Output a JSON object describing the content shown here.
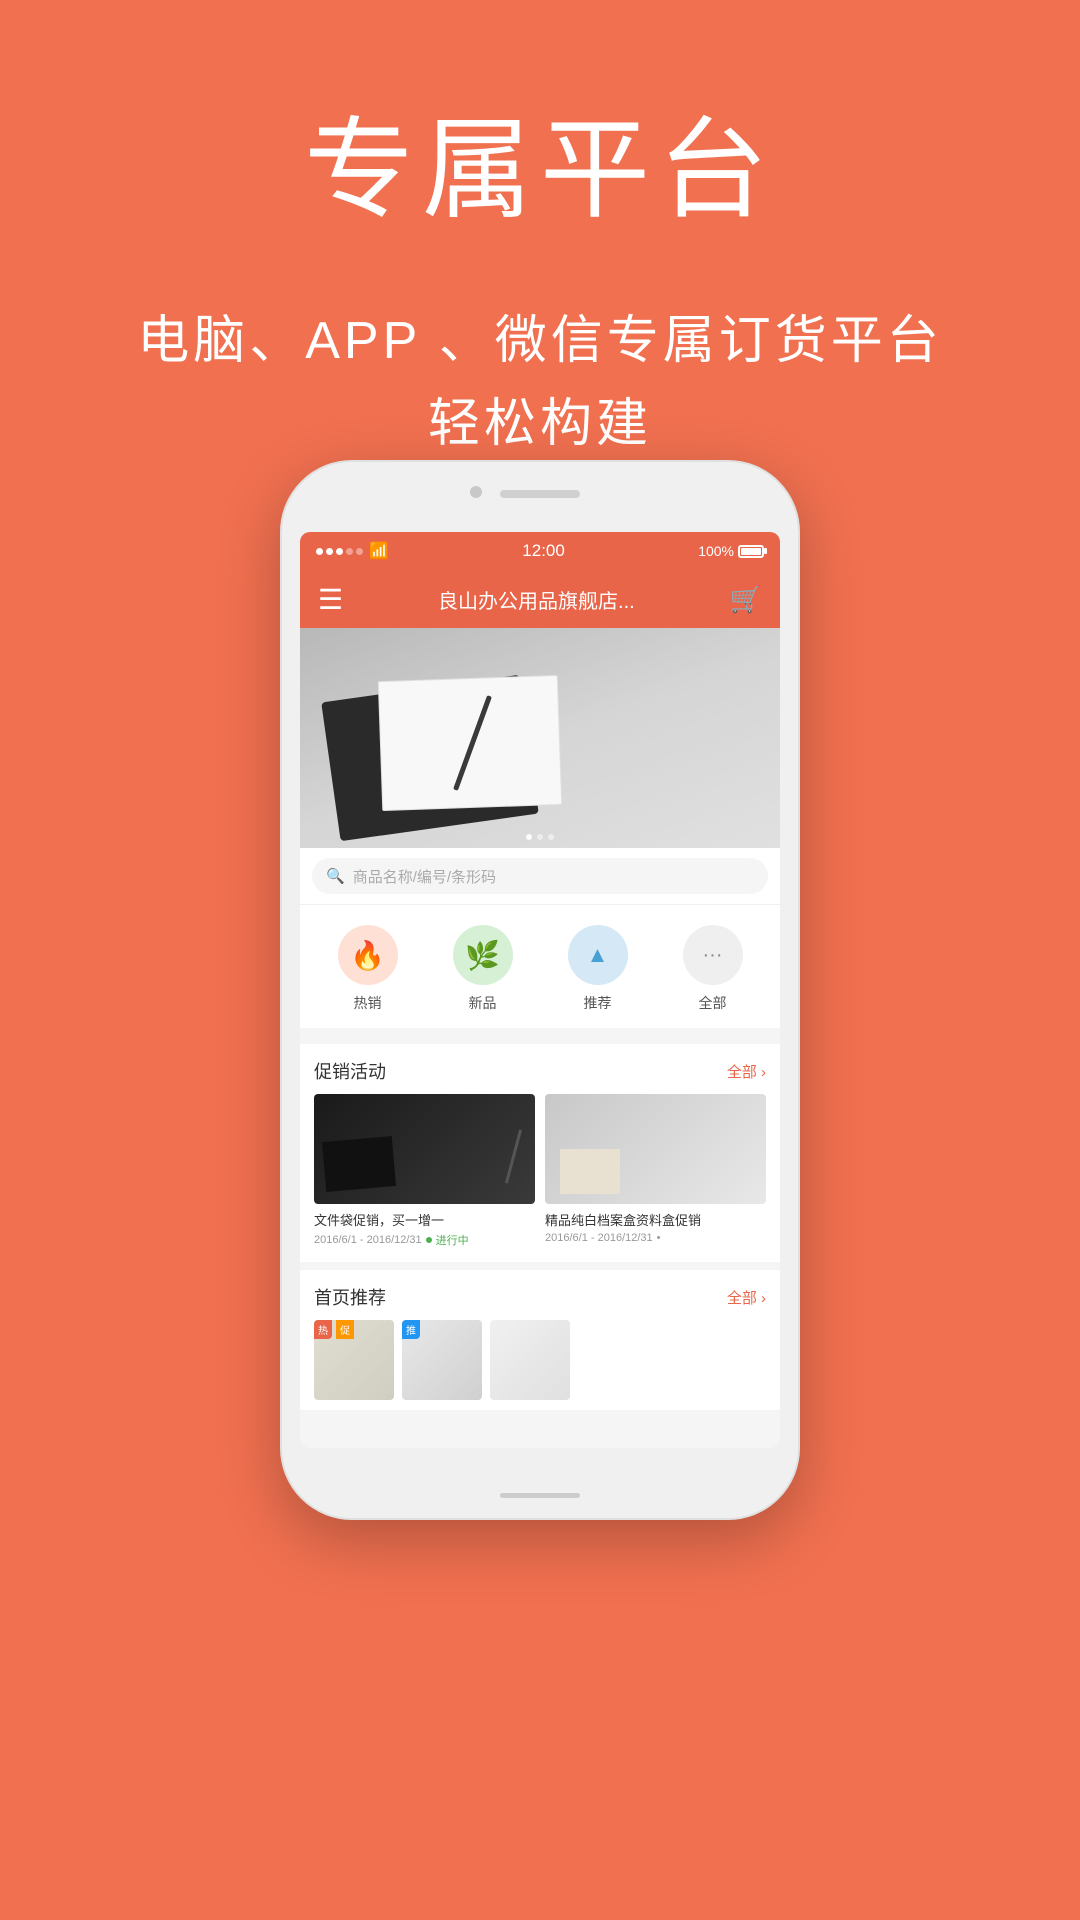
{
  "page": {
    "background_color": "#F07050"
  },
  "hero": {
    "title": "专属平台",
    "subtitle_line1": "电脑、APP 、微信专属订货平台",
    "subtitle_line2": "轻松构建"
  },
  "phone": {
    "status_bar": {
      "time": "12:00",
      "battery": "100%"
    },
    "navbar": {
      "title": "良山办公用品旗舰店...",
      "menu_icon": "≡",
      "cart_icon": "🛒"
    },
    "search": {
      "placeholder": "商品名称/编号/条形码"
    },
    "categories": [
      {
        "id": "hot",
        "label": "热销",
        "icon": "🔥",
        "style": "cat-hot"
      },
      {
        "id": "new",
        "label": "新品",
        "icon": "🌿",
        "style": "cat-new"
      },
      {
        "id": "recommend",
        "label": "推荐",
        "icon": "▲",
        "style": "cat-recommend"
      },
      {
        "id": "all",
        "label": "全部",
        "icon": "···",
        "style": "cat-all"
      }
    ],
    "promotions": {
      "title": "促销活动",
      "more_label": "全部 ›",
      "items": [
        {
          "title": "文件袋促销，买一增一",
          "date_range": "2016/6/1 - 2016/12/31",
          "status": "进行中",
          "status_color": "#4CAF50"
        },
        {
          "title": "精品纯白档案盒资料盒促销",
          "date_range": "2016/6/1 - 2016/12/31",
          "status": "•",
          "status_color": "#999"
        }
      ]
    },
    "recommendations": {
      "title": "首页推荐",
      "more_label": "全部 ›"
    }
  }
}
